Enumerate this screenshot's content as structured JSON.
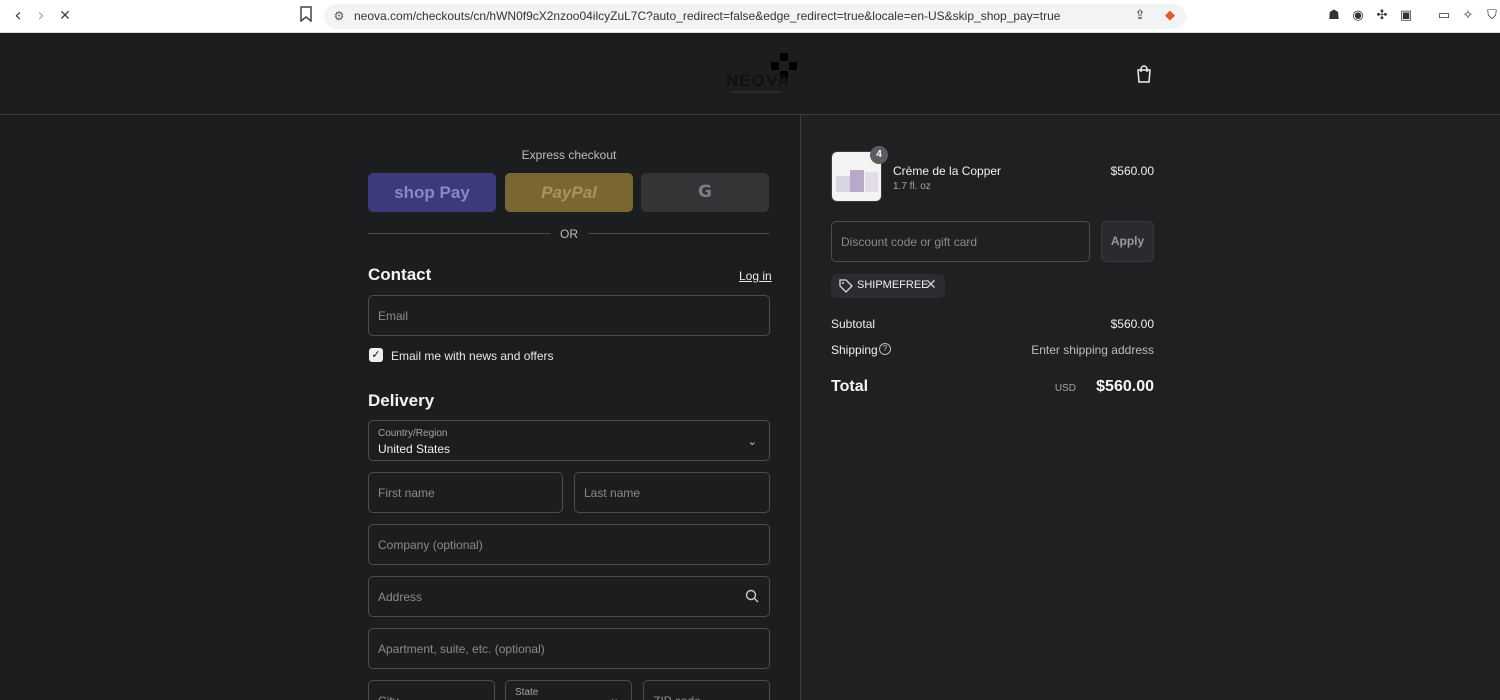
{
  "browser": {
    "url": "neova.com/checkouts/cn/hWN0f9cX2nzoo04ilcyZuL7C?auto_redirect=false&edge_redirect=true&locale=en-US&skip_shop_pay=true",
    "back_icon": "chevron-left-icon",
    "forward_icon": "chevron-right-icon",
    "stop_icon": "close-icon"
  },
  "header": {
    "logo": "NEOVA",
    "cart_icon": "shopping-bag-icon"
  },
  "express": {
    "title": "Express checkout",
    "shop_pay": "shop Pay",
    "paypal": "PayPal",
    "google": "G",
    "or": "OR"
  },
  "contact": {
    "title": "Contact",
    "login": "Log in",
    "email_placeholder": "Email",
    "newsletter_label": "Email me with news and offers",
    "newsletter_checked": true
  },
  "delivery": {
    "title": "Delivery",
    "country_label": "Country/Region",
    "country_value": "United States",
    "first_name_placeholder": "First name",
    "last_name_placeholder": "Last name",
    "company_placeholder": "Company (optional)",
    "address_placeholder": "Address",
    "apartment_placeholder": "Apartment, suite, etc. (optional)",
    "city_placeholder": "City",
    "state_label": "State",
    "zip_placeholder": "ZIP code"
  },
  "order": {
    "product": {
      "name": "Crème de la Copper",
      "variant": "1.7 fl. oz",
      "price": "$560.00",
      "quantity": "4"
    },
    "discount_placeholder": "Discount code or gift card",
    "apply": "Apply",
    "applied_code": "SHIPMEFREE",
    "subtotal_label": "Subtotal",
    "subtotal_value": "$560.00",
    "shipping_label": "Shipping",
    "shipping_value": "Enter shipping address",
    "total_label": "Total",
    "total_currency": "USD",
    "total_value": "$560.00"
  }
}
